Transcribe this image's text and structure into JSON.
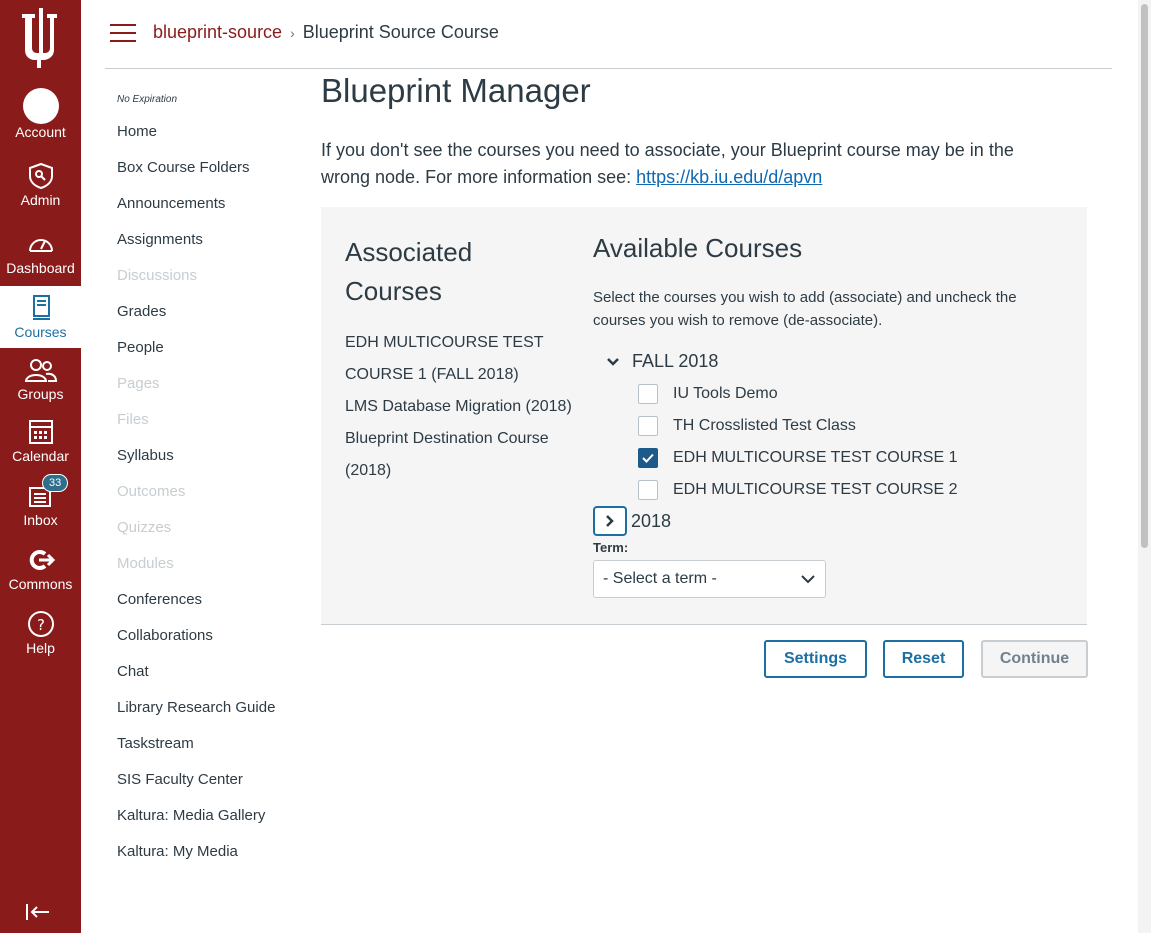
{
  "global_nav": {
    "items": [
      {
        "label": "Account",
        "icon": "account-avatar"
      },
      {
        "label": "Admin",
        "icon": "shield-icon"
      },
      {
        "label": "Dashboard",
        "icon": "dashboard-icon"
      },
      {
        "label": "Courses",
        "icon": "book-icon"
      },
      {
        "label": "Groups",
        "icon": "groups-icon"
      },
      {
        "label": "Calendar",
        "icon": "calendar-icon"
      },
      {
        "label": "Inbox",
        "icon": "inbox-icon",
        "badge": "33"
      },
      {
        "label": "Commons",
        "icon": "commons-icon"
      },
      {
        "label": "Help",
        "icon": "help-icon"
      }
    ],
    "brand_color": "#8a1b1b"
  },
  "breadcrumb": {
    "root": "blueprint-source",
    "current": "Blueprint Source Course"
  },
  "course_nav": {
    "expiration": "No Expiration",
    "links": [
      {
        "label": "Home",
        "disabled": false
      },
      {
        "label": "Box Course Folders",
        "disabled": false
      },
      {
        "label": "Announcements",
        "disabled": false
      },
      {
        "label": "Assignments",
        "disabled": false
      },
      {
        "label": "Discussions",
        "disabled": true
      },
      {
        "label": "Grades",
        "disabled": false
      },
      {
        "label": "People",
        "disabled": false
      },
      {
        "label": "Pages",
        "disabled": true
      },
      {
        "label": "Files",
        "disabled": true
      },
      {
        "label": "Syllabus",
        "disabled": false
      },
      {
        "label": "Outcomes",
        "disabled": true
      },
      {
        "label": "Quizzes",
        "disabled": true
      },
      {
        "label": "Modules",
        "disabled": true
      },
      {
        "label": "Conferences",
        "disabled": false
      },
      {
        "label": "Collaborations",
        "disabled": false
      },
      {
        "label": "Chat",
        "disabled": false
      },
      {
        "label": "Library Research Guide",
        "disabled": false
      },
      {
        "label": "Taskstream",
        "disabled": false
      },
      {
        "label": "SIS Faculty Center",
        "disabled": false
      },
      {
        "label": "Kaltura: Media Gallery",
        "disabled": false
      },
      {
        "label": "Kaltura: My Media",
        "disabled": false
      }
    ]
  },
  "main": {
    "title": "Blueprint Manager",
    "intro_text": "If you don't see the courses you need to associate, your Blueprint course may be in the wrong node. For more information see: ",
    "intro_link": "https://kb.iu.edu/d/apvn",
    "associated": {
      "heading": "Associated Courses",
      "courses": [
        "EDH MULTICOURSE TEST COURSE 1 (FALL 2018)",
        "LMS Database Migration (2018)",
        "Blueprint Destination Course (2018)"
      ]
    },
    "available": {
      "heading": "Available Courses",
      "description": "Select the courses you wish to add (associate) and uncheck the courses you wish to remove (de-associate).",
      "term_open": "FALL 2018",
      "courses": [
        {
          "name": "IU Tools Demo",
          "checked": false
        },
        {
          "name": "TH Crosslisted Test Class",
          "checked": false
        },
        {
          "name": "EDH MULTICOURSE TEST COURSE 1",
          "checked": true
        },
        {
          "name": "EDH MULTICOURSE TEST COURSE 2",
          "checked": false
        }
      ],
      "term_collapsed": "2018",
      "term_label": "Term:",
      "term_select": "- Select a term -"
    },
    "buttons": {
      "settings": "Settings",
      "reset": "Reset",
      "continue": "Continue"
    }
  }
}
